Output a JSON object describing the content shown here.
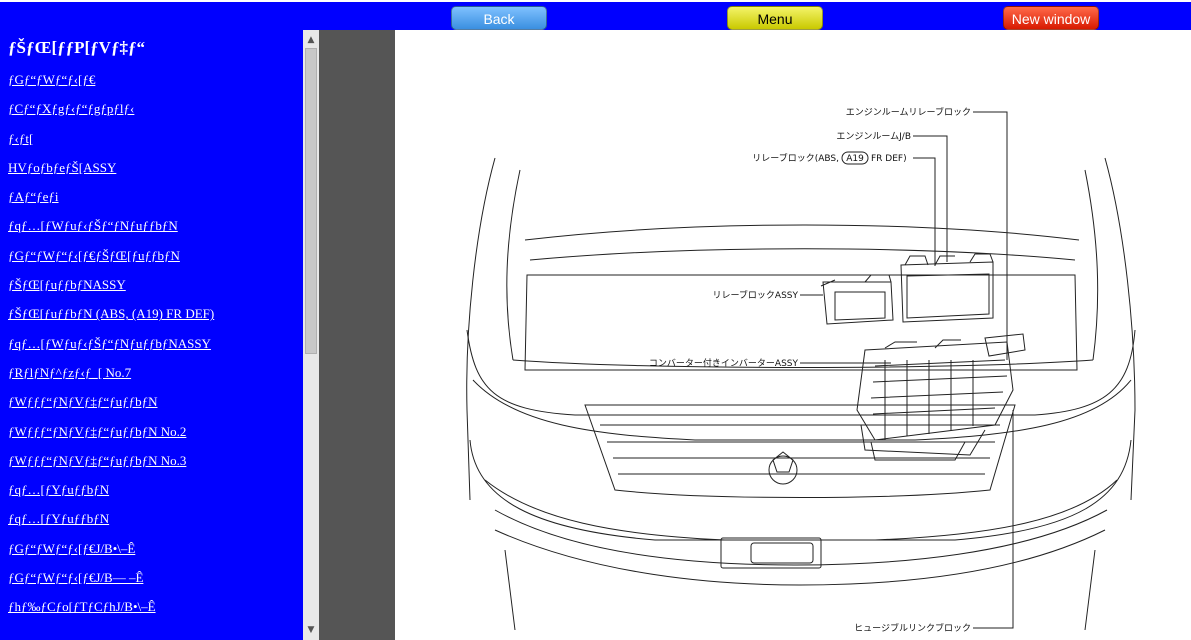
{
  "toolbar": {
    "back_label": "Back",
    "menu_label": "Menu",
    "new_window_label": "New window"
  },
  "sidebar": {
    "title": "ƒŠƒŒ[ƒƒP[ƒVƒ‡ƒ“",
    "items": [
      "ƒGƒ“ƒWƒ“ƒ‹[ƒ€",
      "ƒCƒ“ƒXƒgƒ‹ƒ“ƒgƒpƒlƒ‹",
      "ƒ‹ƒt[",
      "HVƒoƒbƒeƒŠ[ASSY",
      "ƒAƒ“ƒeƒi",
      "ƒqƒ…[ƒWƒuƒ‹ƒŠƒ“ƒNƒuƒƒbƒN",
      "ƒGƒ“ƒWƒ“ƒ‹[ƒ€ƒŠƒŒ[ƒuƒƒbƒN",
      "ƒŠƒŒ[ƒuƒƒbƒNASSY",
      "ƒŠƒŒ[ƒuƒƒbƒN (ABS, (A19) FR DEF)",
      "ƒqƒ…[ƒWƒuƒ‹ƒŠƒ“ƒNƒuƒƒbƒNASSY",
      "ƒRƒlƒNƒ^ƒzƒ‹ƒ_[ No.7",
      "ƒWƒƒƒ“ƒNƒVƒ‡ƒ“ƒuƒƒbƒN",
      "ƒWƒƒƒ“ƒNƒVƒ‡ƒ“ƒuƒƒbƒN No.2",
      "ƒWƒƒƒ“ƒNƒVƒ‡ƒ“ƒuƒƒbƒN No.3",
      "ƒqƒ…[ƒYƒuƒƒbƒN",
      "ƒqƒ…[ƒYƒuƒƒbƒN",
      "ƒGƒ“ƒWƒ“ƒ‹[ƒ€J/B•\\–Ê",
      "ƒGƒ“ƒWƒ“ƒ‹[ƒ€J/B— –Ê",
      "ƒhƒ‰ƒCƒo[ƒTƒCƒhJ/B•\\–Ê"
    ]
  },
  "diagram": {
    "labels": {
      "engine_room_relay_block": "エンジンルームリレーブロック",
      "engine_room_jb": "エンジンルームJ/B",
      "relay_block_abs_prefix": "リレーブロック(ABS,",
      "relay_block_abs_badge": "A19",
      "relay_block_abs_suffix": "FR DEF)",
      "relay_block_assy": "リレーブロックASSY",
      "converter_inverter_assy": "コンバーター付きインバーターASSY",
      "fusible_link_block": "ヒュージブルリンクブロック"
    }
  }
}
